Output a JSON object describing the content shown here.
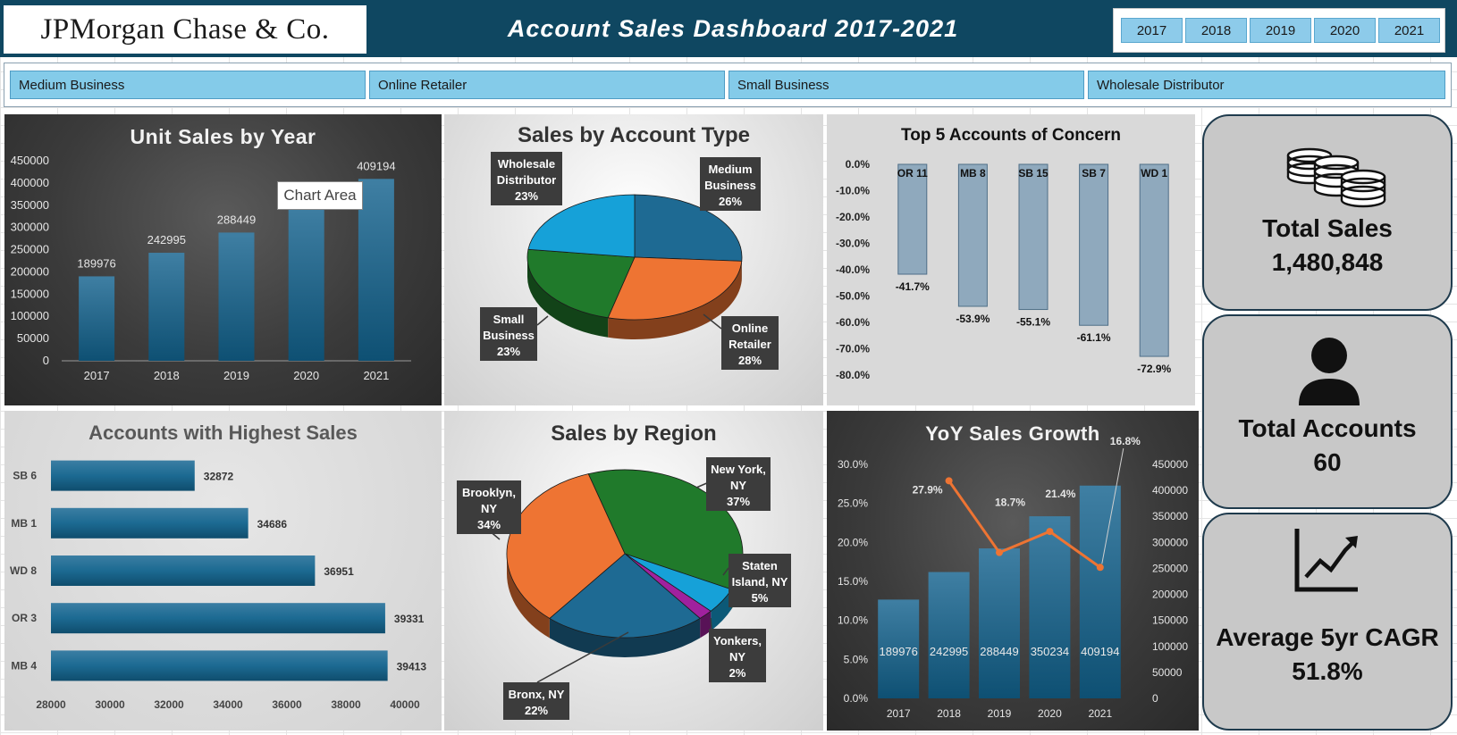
{
  "header": {
    "logo_text": "JPMorgan Chase & Co.",
    "title": "Account Sales Dashboard 2017-2021",
    "year_slicer": [
      "2017",
      "2018",
      "2019",
      "2020",
      "2021"
    ]
  },
  "filters": [
    "Medium Business",
    "Online Retailer",
    "Small Business",
    "Wholesale Distributor"
  ],
  "tooltip": "Chart Area",
  "cards": {
    "total_sales_label": "Total Sales",
    "total_sales_value": "1,480,848",
    "total_accounts_label": "Total Accounts",
    "total_accounts_value": "60",
    "cagr_label": "Average 5yr CAGR",
    "cagr_value": "51.8%"
  },
  "colors": {
    "header": "#0f4761",
    "slicer": "#84cbe9",
    "bar": "#1e6a93",
    "pie_blue": "#1e6a93",
    "pie_orange": "#ee7433",
    "pie_green": "#207a2b",
    "pie_cyan": "#16a1d8",
    "pie_purple": "#a0219e",
    "growth_line": "#ee7433"
  },
  "chart_data": [
    {
      "id": "unit_sales",
      "type": "bar",
      "title": "Unit Sales by Year",
      "categories": [
        "2017",
        "2018",
        "2019",
        "2020",
        "2021"
      ],
      "values": [
        189976,
        242995,
        288449,
        350234,
        409194
      ],
      "data_labels": [
        "189976",
        "242995",
        "288449",
        "",
        "409194"
      ],
      "y_ticks": [
        "450000",
        "400000",
        "350000",
        "300000",
        "250000",
        "200000",
        "150000",
        "100000",
        "50000",
        "0"
      ],
      "ylim": [
        0,
        450000
      ]
    },
    {
      "id": "account_type",
      "type": "pie",
      "title": "Sales by Account Type",
      "labels": [
        "Medium Business",
        "Online Retailer",
        "Small Business",
        "Wholesale Distributor"
      ],
      "values": [
        26,
        28,
        23,
        23
      ],
      "label_lines": [
        [
          "Medium",
          "Business",
          "26%"
        ],
        [
          "Online",
          "Retailer",
          "28%"
        ],
        [
          "Small",
          "Business",
          "23%"
        ],
        [
          "Wholesale",
          "Distributor",
          "23%"
        ]
      ]
    },
    {
      "id": "concern",
      "type": "bar",
      "title": "Top 5 Accounts of Concern",
      "categories": [
        "OR 11",
        "MB 8",
        "SB 15",
        "SB 7",
        "WD 1"
      ],
      "values": [
        -41.7,
        -53.9,
        -55.1,
        -61.1,
        -72.9
      ],
      "data_labels": [
        "-41.7%",
        "-53.9%",
        "-55.1%",
        "-61.1%",
        "-72.9%"
      ],
      "y_ticks": [
        "0.0%",
        "-10.0%",
        "-20.0%",
        "-30.0%",
        "-40.0%",
        "-50.0%",
        "-60.0%",
        "-70.0%",
        "-80.0%"
      ],
      "ylim": [
        -80,
        0
      ]
    },
    {
      "id": "highest_sales",
      "type": "bar",
      "title": "Accounts with Highest Sales",
      "categories": [
        "SB 6",
        "MB 1",
        "WD 8",
        "OR 3",
        "MB 4"
      ],
      "values": [
        32872,
        34686,
        36951,
        39331,
        39413
      ],
      "data_labels": [
        "32872",
        "34686",
        "36951",
        "39331",
        "39413"
      ],
      "x_ticks": [
        "28000",
        "30000",
        "32000",
        "34000",
        "36000",
        "38000",
        "40000"
      ],
      "xlim": [
        28000,
        40000
      ]
    },
    {
      "id": "region",
      "type": "pie",
      "title": "Sales by Region",
      "labels": [
        "New York, NY",
        "Staten Island, NY",
        "Yonkers, NY",
        "Bronx, NY",
        "Brooklyn, NY"
      ],
      "values": [
        37,
        5,
        2,
        22,
        34
      ],
      "label_lines": [
        [
          "New York,",
          "NY",
          "37%"
        ],
        [
          "Staten",
          "Island, NY",
          "5%"
        ],
        [
          "Yonkers,",
          "NY",
          "2%"
        ],
        [
          "Bronx, NY",
          "22%"
        ],
        [
          "Brooklyn,",
          "NY",
          "34%"
        ]
      ]
    },
    {
      "id": "yoy_growth",
      "type": "bar",
      "title": "YoY Sales Growth",
      "categories": [
        "2017",
        "2018",
        "2019",
        "2020",
        "2021"
      ],
      "bar_values": [
        189976,
        242995,
        288449,
        350234,
        409194
      ],
      "bar_labels": [
        "189976",
        "242995",
        "288449",
        "350234",
        "409194"
      ],
      "line_values": [
        27.9,
        18.7,
        21.4,
        16.8
      ],
      "line_categories": [
        "2018",
        "2019",
        "2020",
        "2021"
      ],
      "line_labels": [
        "27.9%",
        "18.7%",
        "21.4%",
        "16.8%"
      ],
      "y_left_ticks": [
        "30.0%",
        "25.0%",
        "20.0%",
        "15.0%",
        "10.0%",
        "5.0%",
        "0.0%"
      ],
      "y_right_ticks": [
        "450000",
        "400000",
        "350000",
        "300000",
        "250000",
        "200000",
        "150000",
        "100000",
        "50000",
        "0"
      ],
      "ylim_left": [
        0,
        30
      ],
      "ylim_right": [
        0,
        450000
      ]
    }
  ]
}
